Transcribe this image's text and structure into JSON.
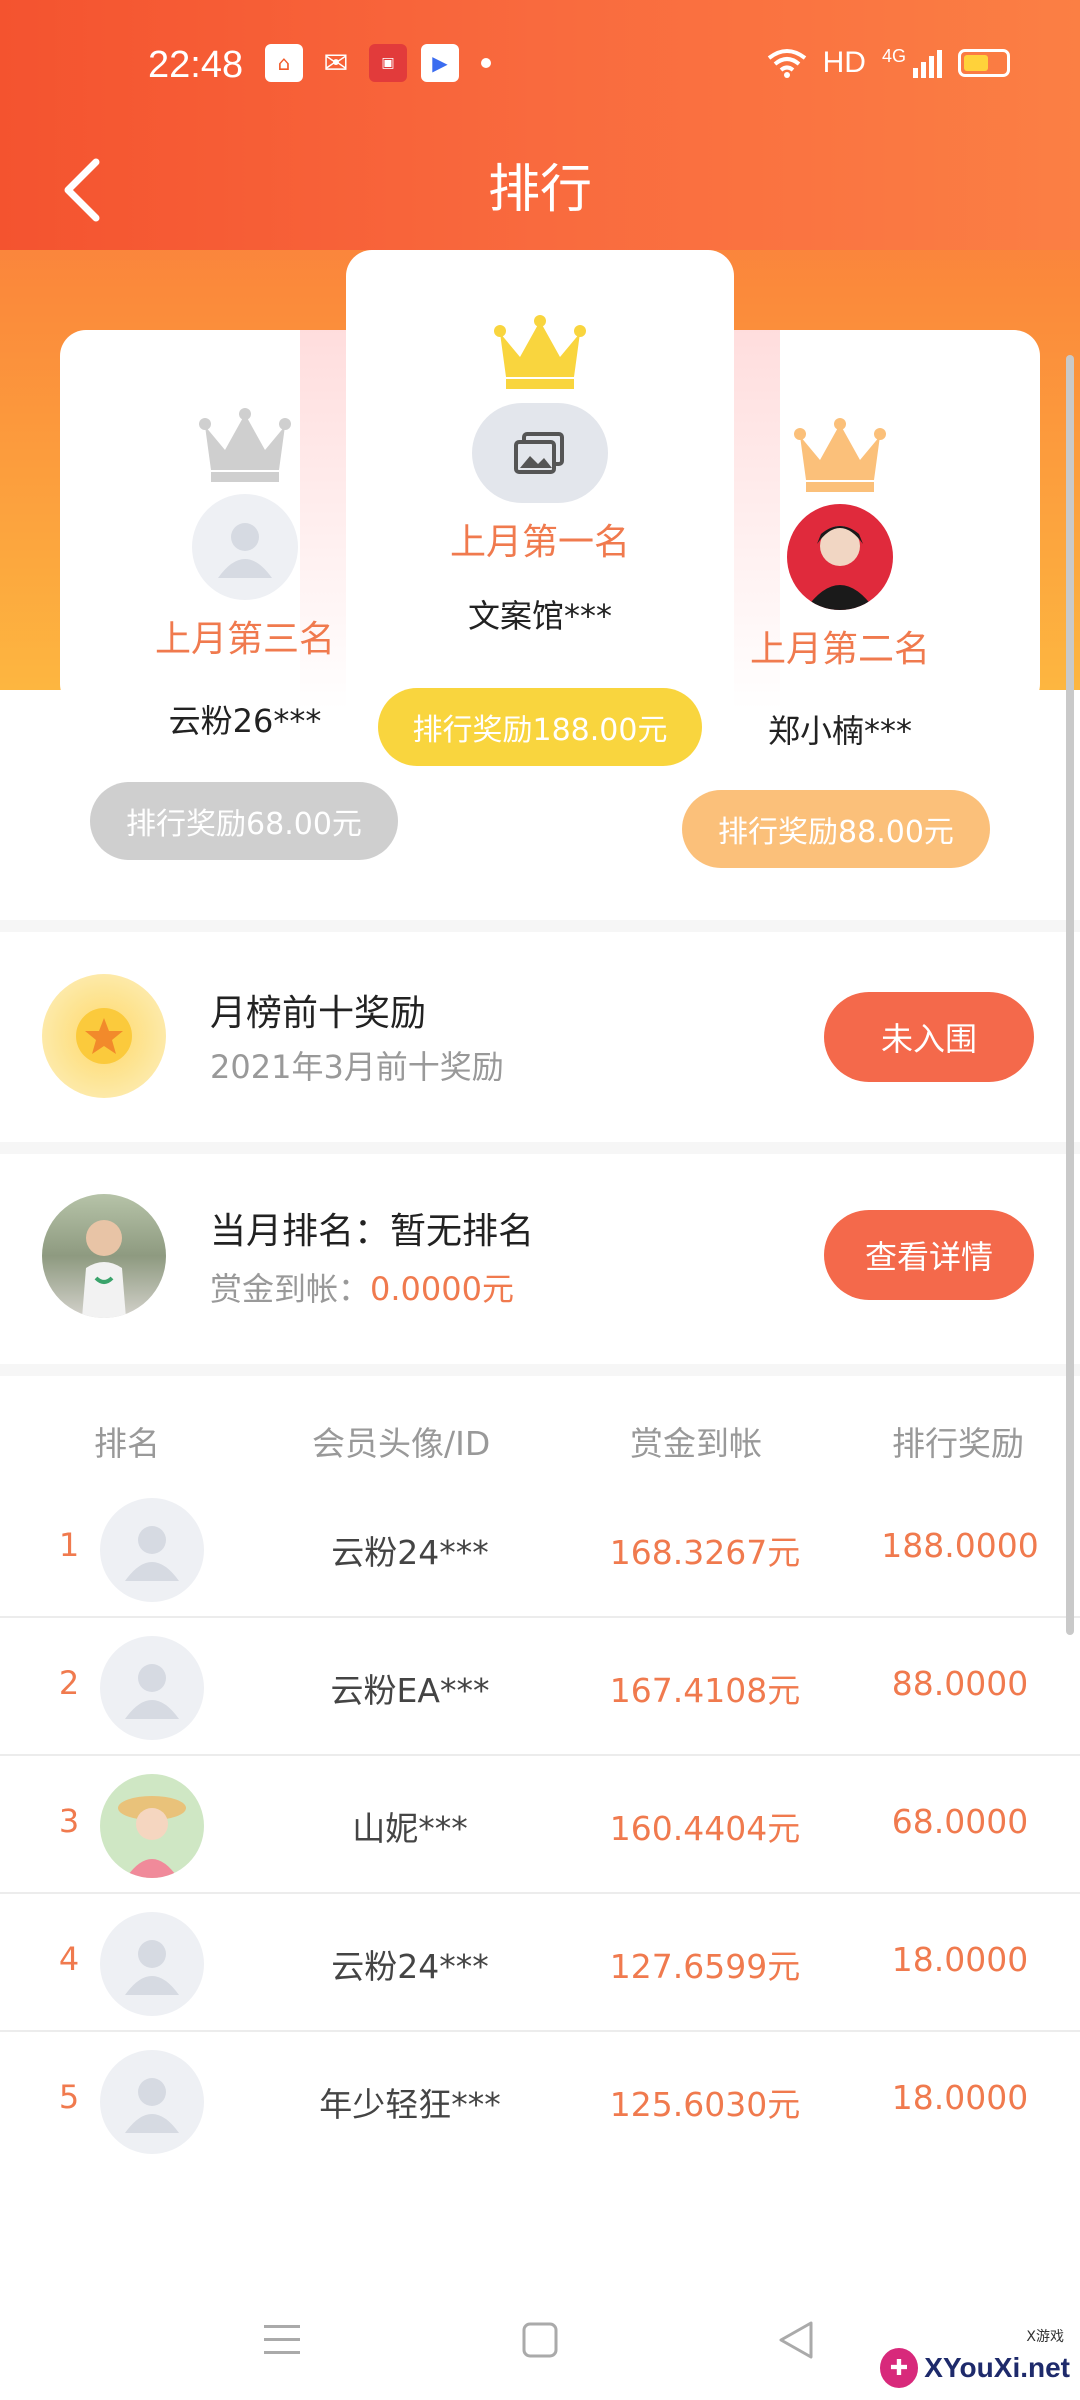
{
  "status": {
    "time": "22:48",
    "network": "HD",
    "signal": "4G"
  },
  "nav": {
    "title": "排行"
  },
  "podium": {
    "first": {
      "title": "上月第一名",
      "user": "文案馆***",
      "reward": "排行奖励188.00元"
    },
    "second": {
      "title": "上月第二名",
      "user": "郑小楠***",
      "reward": "排行奖励88.00元"
    },
    "third": {
      "title": "上月第三名",
      "user": "云粉26***",
      "reward": "排行奖励68.00元"
    }
  },
  "top10": {
    "title": "月榜前十奖励",
    "subtitle": "2021年3月前十奖励",
    "button": "未入围"
  },
  "current": {
    "rank_label": "当月排名：暂无排名",
    "bounty_label": "赏金到帐：",
    "bounty_value": "0.0000元",
    "button": "查看详情"
  },
  "table": {
    "headers": [
      "排名",
      "会员头像/ID",
      "赏金到帐",
      "排行奖励"
    ],
    "rows": [
      {
        "rank": "1",
        "id": "云粉24***",
        "money": "168.3267元",
        "reward": "188.0000"
      },
      {
        "rank": "2",
        "id": "云粉EA***",
        "money": "167.4108元",
        "reward": "88.0000"
      },
      {
        "rank": "3",
        "id": "山妮***",
        "money": "160.4404元",
        "reward": "68.0000"
      },
      {
        "rank": "4",
        "id": "云粉24***",
        "money": "127.6599元",
        "reward": "18.0000"
      },
      {
        "rank": "5",
        "id": "年少轻狂***",
        "money": "125.6030元",
        "reward": "18.0000"
      }
    ]
  },
  "watermark": {
    "text": "XYouXi.net",
    "small": "X游戏"
  },
  "colors": {
    "accent": "#f4694b",
    "gold": "#f9d53e",
    "silver": "#cfcfcf",
    "bronze": "#fbc07a"
  }
}
